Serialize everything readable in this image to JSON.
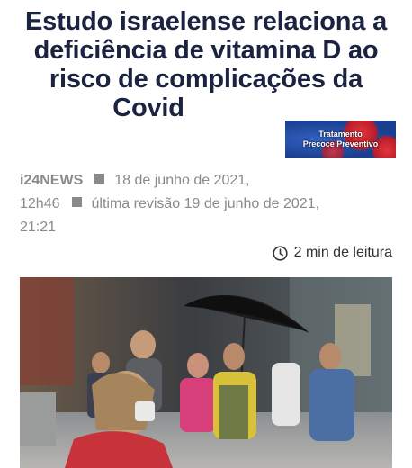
{
  "article": {
    "headline_lines": [
      "Estudo israelense relaciona a",
      "deficiência de vitamina D ao",
      "risco de complicações da",
      "Covid"
    ],
    "source": "i24NEWS",
    "published": "18 de junho de 2021,",
    "published_time": "12h46",
    "revised": "última revisão 19 de junho de 2021,",
    "revised_time": "21:21",
    "read_time": "2 min de leitura"
  },
  "banner": {
    "line1": "Tratamento",
    "line2": "Precoce Preventivo"
  },
  "icons": {
    "read_time": "clock-icon",
    "separator": "square-separator-icon"
  },
  "colors": {
    "headline": "#1c2340",
    "meta": "#8a8a8a",
    "banner_bg": "#1a3f8f"
  }
}
